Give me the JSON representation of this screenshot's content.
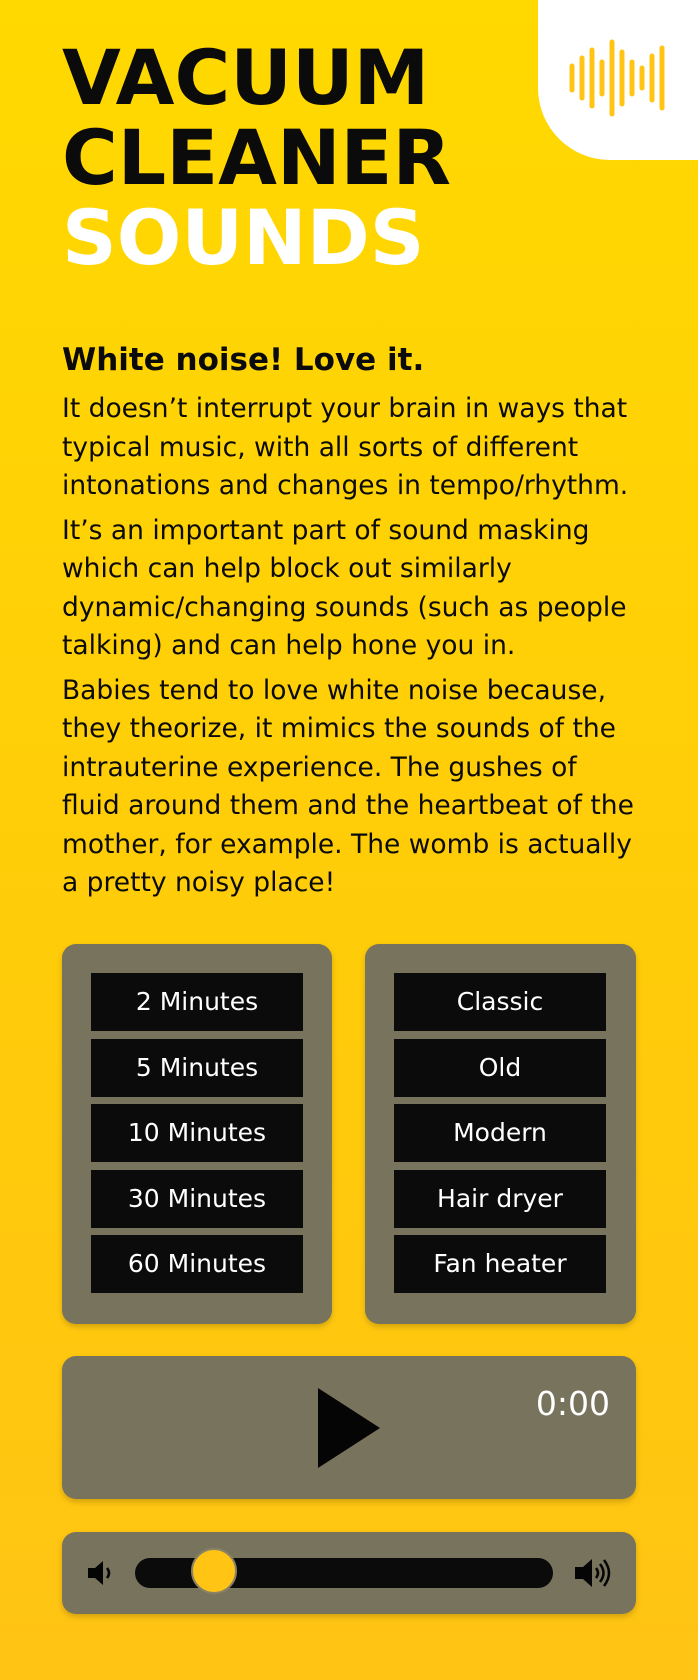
{
  "header": {
    "title_line1": "VACUUM",
    "title_line2": "CLEANER",
    "title_line3": "SOUNDS",
    "logo_icon": "sound-wave-icon"
  },
  "intro": {
    "heading": "White noise! Love it.",
    "paragraphs": [
      "It doesn’t interrupt your brain in ways that typical music, with all sorts of different intonations and changes in tempo/rhythm.",
      "It’s an important part of sound masking which can help block out similarly dynamic/changing sounds (such as people talking) and can help hone you in.",
      "Babies tend to love white noise because, they theorize, it mimics the sounds of the intrauterine experience. The gushes of fluid around them and the heartbeat of the mother, for example. The womb is actually a pretty noisy place!"
    ]
  },
  "durations": [
    "2 Minutes",
    "5 Minutes",
    "10 Minutes",
    "30 Minutes",
    "60 Minutes"
  ],
  "sounds": [
    "Classic",
    "Old",
    "Modern",
    "Hair dryer",
    "Fan heater"
  ],
  "player": {
    "time": "0:00",
    "play_icon": "play-icon"
  },
  "volume": {
    "level": 0.19,
    "low_icon": "volume-low-icon",
    "high_icon": "volume-high-icon"
  },
  "colors": {
    "background": "#FFD200",
    "panel": "#78735C",
    "button": "#0B0B0B",
    "accent": "#FFC414"
  }
}
